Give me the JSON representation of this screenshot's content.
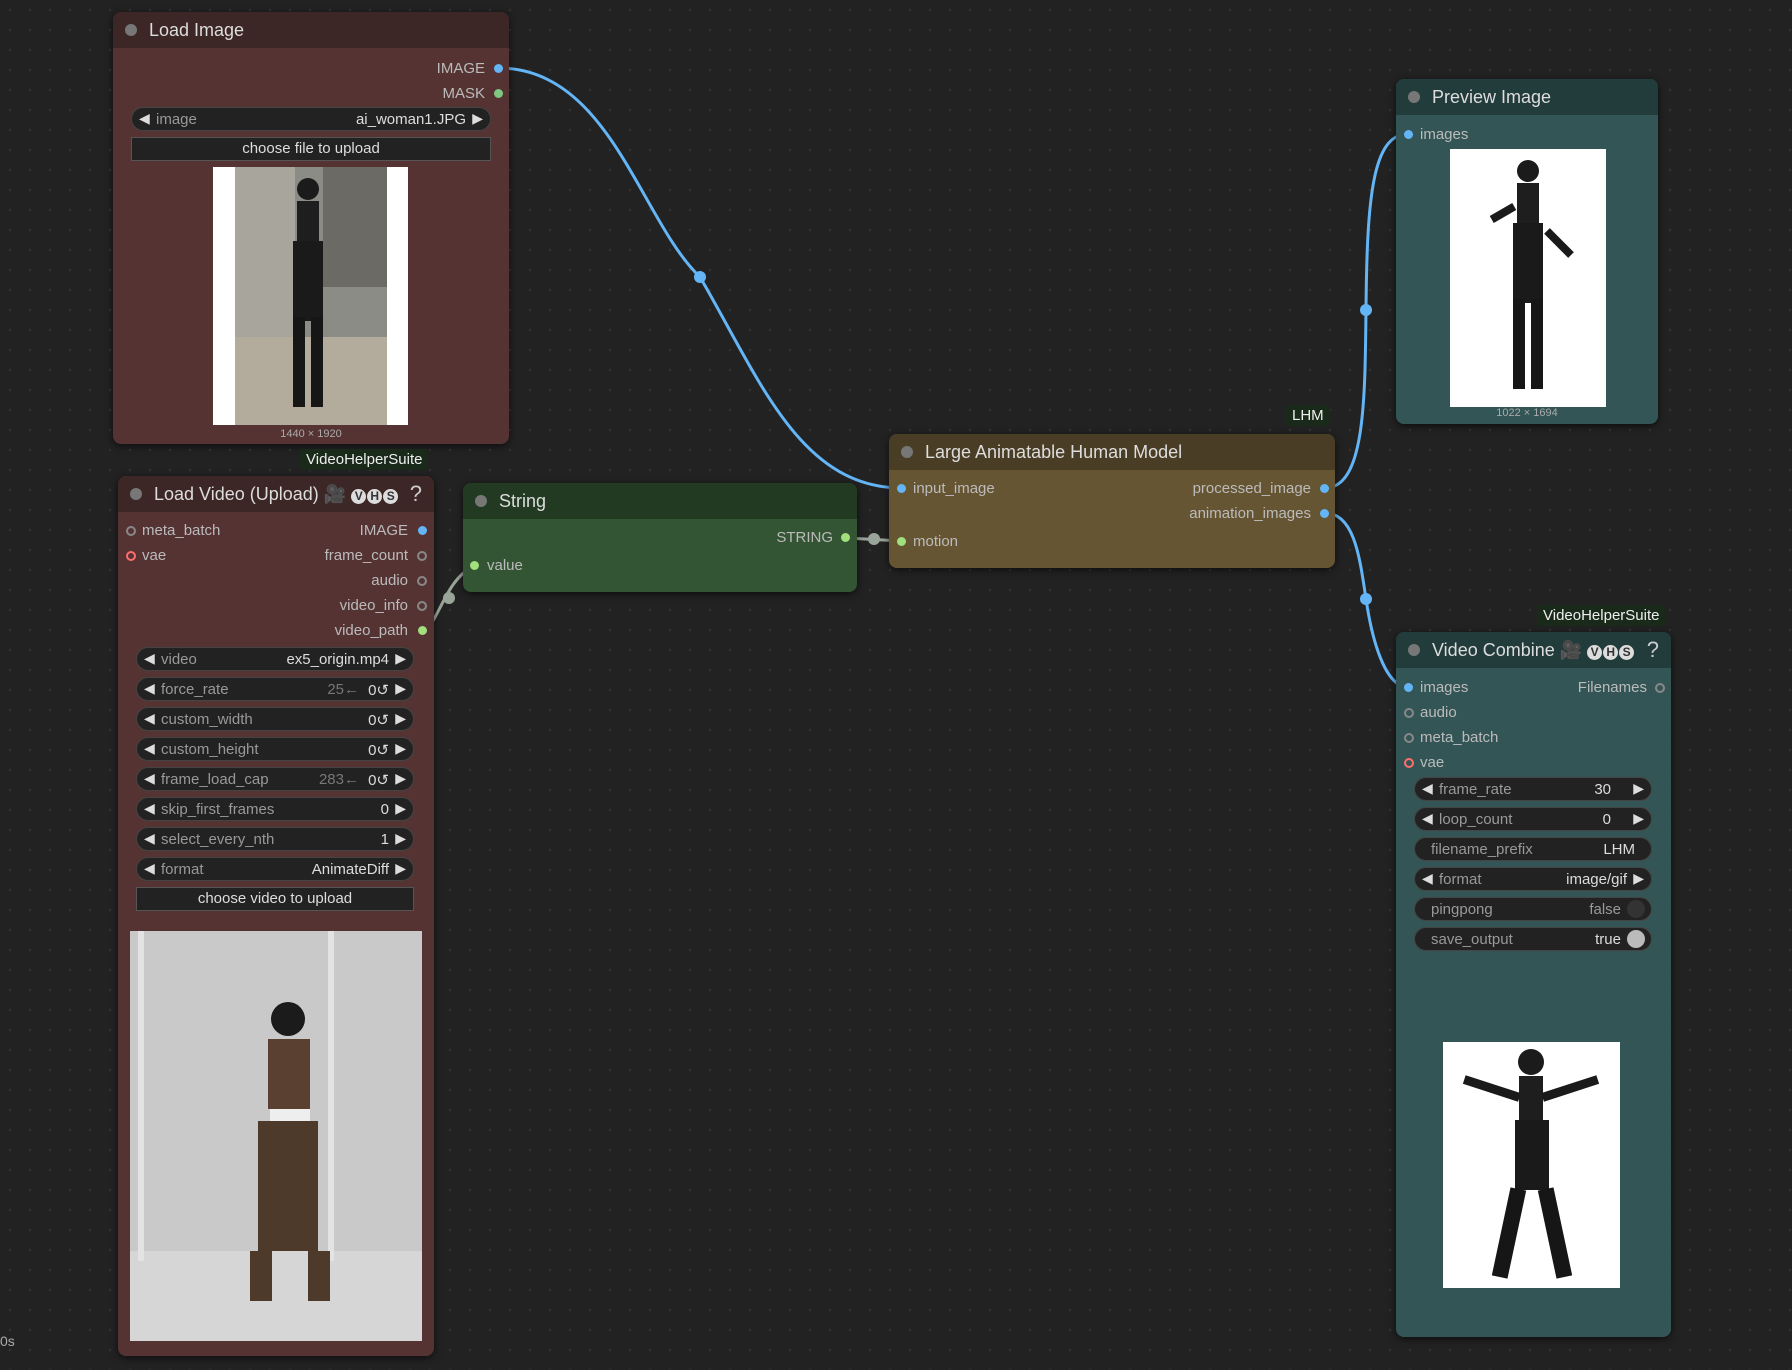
{
  "colors": {
    "canvas_bg": "#222222",
    "load_node_body": "#553333",
    "load_node_title": "#3d2626",
    "string_node_body": "#335533",
    "string_node_title": "#223a22",
    "lhm_node_body": "#665533",
    "lhm_node_title": "#4a3d25",
    "preview_node_body": "#335555",
    "preview_node_title": "#223b3b",
    "image_slot": "#64b5f6",
    "mask_slot": "#81c784",
    "string_slot": "#a1e07c",
    "vae_slot": "#ff6e6e",
    "link_blue": "#64b5f6",
    "link_gray": "#9aa59a",
    "badge_bg": "#1a2a1a"
  },
  "load_image": {
    "title": "Load Image",
    "outputs": [
      "IMAGE",
      "MASK"
    ],
    "image_widget": {
      "label": "image",
      "value": "ai_woman1.JPG"
    },
    "upload_button": "choose file to upload",
    "dimensions": "1440 × 1920"
  },
  "load_video": {
    "badge": "VideoHelperSuite",
    "title": "Load Video (Upload) 🎥",
    "title_badges": [
      "V",
      "H",
      "S"
    ],
    "help": "?",
    "inputs": [
      "meta_batch",
      "vae"
    ],
    "outputs": [
      "IMAGE",
      "frame_count",
      "audio",
      "video_info",
      "video_path"
    ],
    "widgets": [
      {
        "label": "video",
        "value": "ex5_origin.mp4",
        "hint": ""
      },
      {
        "label": "force_rate",
        "value": "0↺",
        "hint": "25←"
      },
      {
        "label": "custom_width",
        "value": "0↺",
        "hint": ""
      },
      {
        "label": "custom_height",
        "value": "0↺",
        "hint": ""
      },
      {
        "label": "frame_load_cap",
        "value": "0↺",
        "hint": "283←"
      },
      {
        "label": "skip_first_frames",
        "value": "0",
        "hint": ""
      },
      {
        "label": "select_every_nth",
        "value": "1",
        "hint": ""
      },
      {
        "label": "format",
        "value": "AnimateDiff",
        "hint": ""
      }
    ],
    "upload_button": "choose video to upload"
  },
  "string_node": {
    "title": "String",
    "output": "STRING",
    "input": "value"
  },
  "lhm_node": {
    "badge": "LHM",
    "title": "Large Animatable Human Model",
    "inputs": [
      "input_image",
      "motion"
    ],
    "outputs": [
      "processed_image",
      "animation_images"
    ]
  },
  "preview_image": {
    "title": "Preview Image",
    "input": "images",
    "dimensions": "1022 × 1694"
  },
  "video_combine": {
    "badge": "VideoHelperSuite",
    "title": "Video Combine 🎥",
    "title_badges": [
      "V",
      "H",
      "S"
    ],
    "help": "?",
    "inputs": [
      "images",
      "audio",
      "meta_batch",
      "vae"
    ],
    "output": "Filenames",
    "widgets": [
      {
        "label": "frame_rate",
        "value": "30",
        "arrows": true
      },
      {
        "label": "loop_count",
        "value": "0",
        "arrows": true
      },
      {
        "label": "filename_prefix",
        "value": "LHM",
        "arrows": false
      },
      {
        "label": "format",
        "value": "image/gif",
        "arrows": true
      },
      {
        "label": "pingpong",
        "value": "false",
        "arrows": false
      },
      {
        "label": "save_output",
        "value": "true",
        "arrows": false
      }
    ]
  },
  "corner_text": "0s"
}
